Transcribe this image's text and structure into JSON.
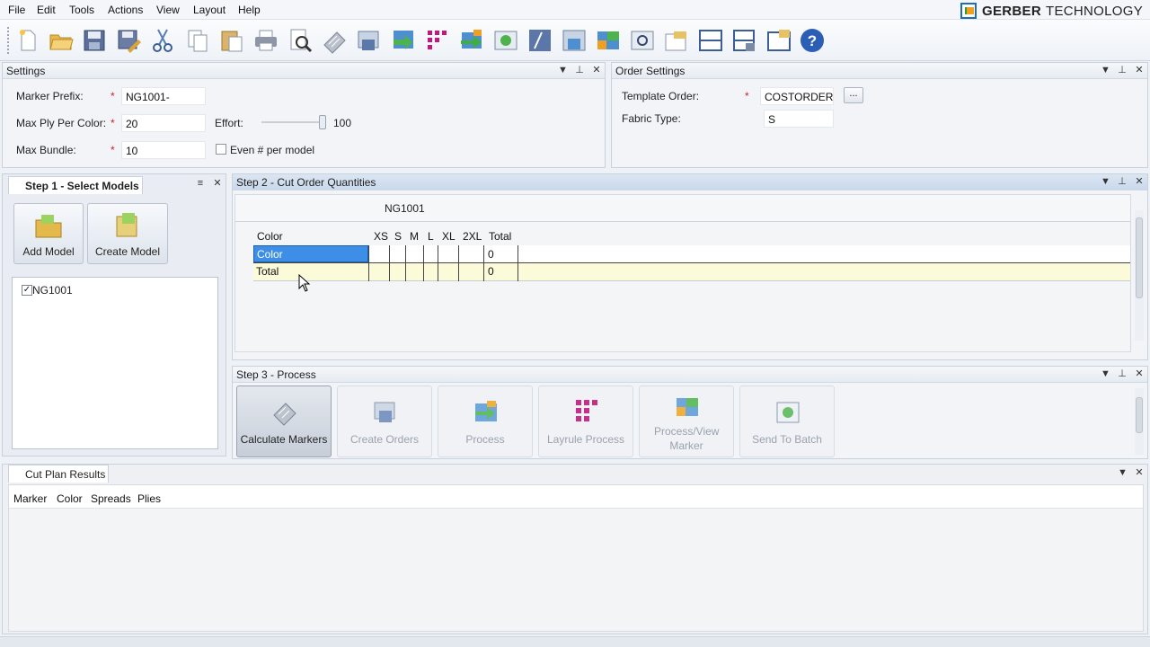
{
  "menu": [
    "File",
    "Edit",
    "Tools",
    "Actions",
    "View",
    "Layout",
    "Help"
  ],
  "brand": {
    "part1": "GERBER",
    "part2": "TECHNOLOGY"
  },
  "toolbar_icons": [
    "new-file-icon",
    "open-folder-icon",
    "save-icon",
    "save-as-icon",
    "cut-icon",
    "copy-icon",
    "paste-icon",
    "print-icon",
    "print-preview-icon",
    "calculator-icon",
    "create-orders-icon",
    "process-icon",
    "layrule-icon",
    "process-arrow-icon",
    "send-batch-icon",
    "marker-icon",
    "order-icon",
    "process-view-icon",
    "search-icon",
    "notes-icon",
    "split-view-icon",
    "batch-icon",
    "export-icon",
    "help-icon"
  ],
  "settings": {
    "title": "Settings",
    "marker_prefix_label": "Marker Prefix:",
    "marker_prefix_value": "NG1001-",
    "max_ply_label": "Max Ply Per Color:",
    "max_ply_value": "20",
    "max_bundle_label": "Max Bundle:",
    "max_bundle_value": "10",
    "effort_label": "Effort:",
    "effort_value": "100",
    "effort_level": 1.0,
    "even_label": "Even # per model",
    "even_checked": false
  },
  "order_settings": {
    "title": "Order Settings",
    "template_label": "Template Order:",
    "template_value": "COSTORDER",
    "browse_label": "...",
    "fabric_label": "Fabric Type:",
    "fabric_value": "S"
  },
  "step1": {
    "title": "Step 1 - Select Models",
    "add_model": "Add Model",
    "create_model": "Create Model",
    "models": [
      {
        "name": "NG1001",
        "checked": true
      }
    ]
  },
  "step2": {
    "title": "Step 2 - Cut Order Quantities",
    "model_header": "NG1001",
    "columns": [
      "Color",
      "XS",
      "S",
      "M",
      "L",
      "XL",
      "2XL",
      "Total"
    ],
    "rows": [
      {
        "label": "Color",
        "total": "0"
      },
      {
        "label": "Total",
        "total": "0"
      }
    ]
  },
  "step3": {
    "title": "Step 3 - Process",
    "buttons": [
      {
        "label": "Calculate Markers",
        "enabled": true
      },
      {
        "label": "Create Orders",
        "enabled": false
      },
      {
        "label": "Process",
        "enabled": false
      },
      {
        "label": "Layrule Process",
        "enabled": false
      },
      {
        "label": "Process/View Marker",
        "enabled": false
      },
      {
        "label": "Send To Batch",
        "enabled": false
      }
    ]
  },
  "results": {
    "title": "Cut Plan Results",
    "columns": [
      "Marker",
      "Color",
      "Spreads",
      "Plies"
    ]
  }
}
